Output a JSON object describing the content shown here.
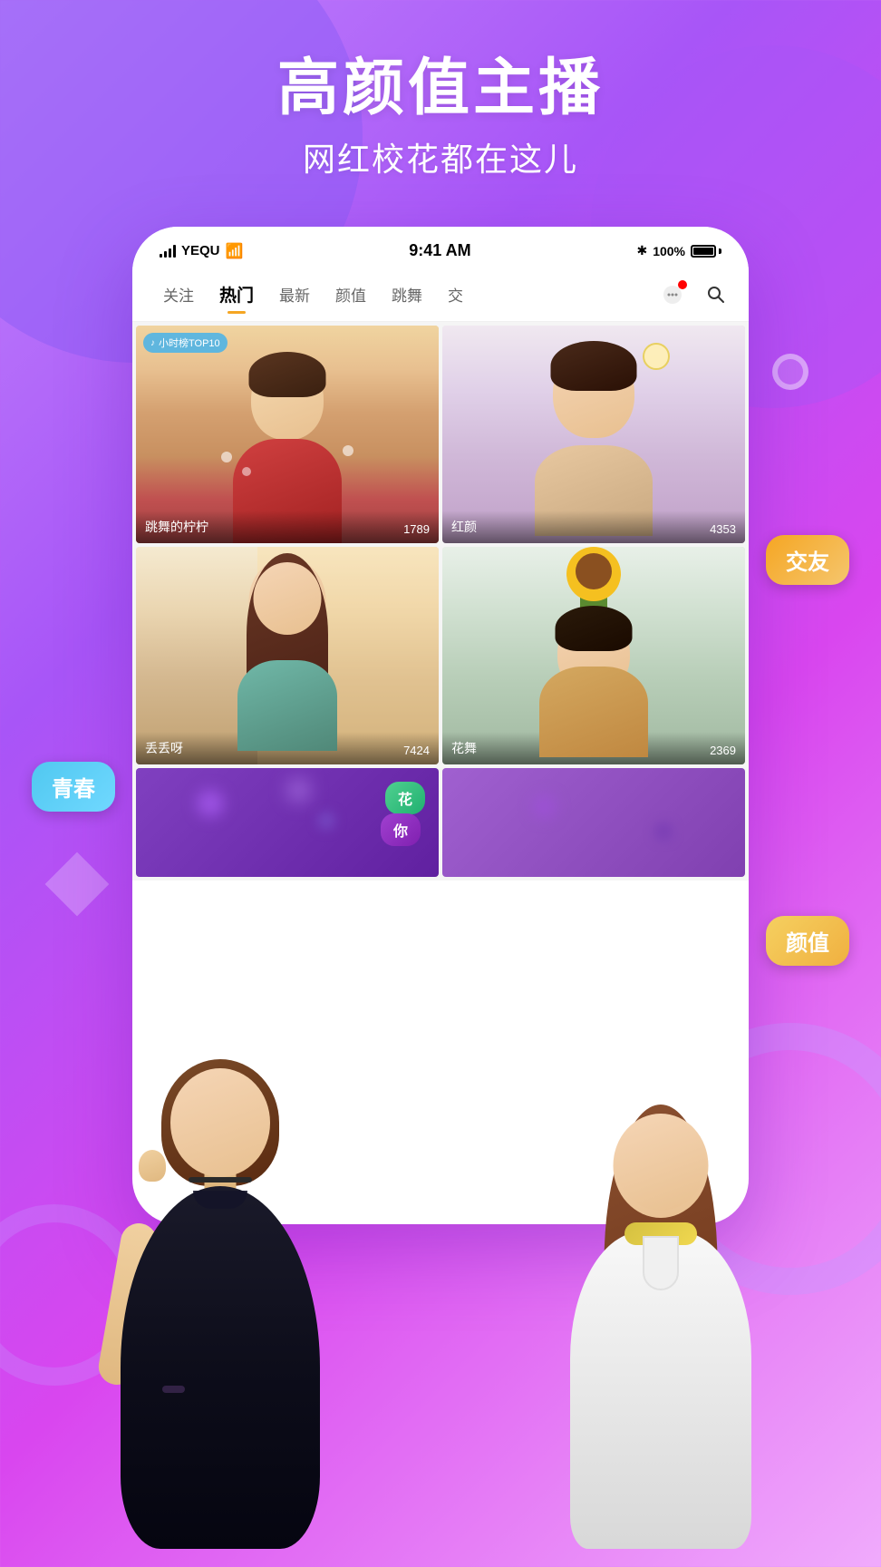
{
  "app": {
    "name": "YEQU"
  },
  "background": {
    "gradient_from": "#c084fc",
    "gradient_to": "#f0abfc"
  },
  "header": {
    "main_title": "高颜值主播",
    "sub_title": "网红校花都在这儿"
  },
  "status_bar": {
    "carrier": "YEQU",
    "time": "9:41 AM",
    "battery": "100%"
  },
  "nav_tabs": [
    {
      "label": "关注",
      "active": false
    },
    {
      "label": "热门",
      "active": true
    },
    {
      "label": "最新",
      "active": false
    },
    {
      "label": "颜值",
      "active": false
    },
    {
      "label": "跳舞",
      "active": false
    },
    {
      "label": "交",
      "active": false
    }
  ],
  "streamers": [
    {
      "name": "跳舞的柠柠",
      "count": "1789",
      "badge": "小时榜TOP10",
      "position": "top-left"
    },
    {
      "name": "红颜",
      "count": "4353",
      "badge": null,
      "position": "top-right"
    },
    {
      "name": "丢丢呀",
      "count": "7424",
      "badge": null,
      "position": "bottom-left"
    },
    {
      "name": "花舞",
      "count": "2369",
      "badge": null,
      "position": "bottom-right"
    }
  ],
  "float_tags": {
    "youjiao": "交友",
    "qingchun": "青春",
    "yanzhi": "颜值"
  },
  "bottom_overlay": {
    "tag_hua": "花",
    "tag_ni": "你"
  },
  "icons": {
    "message": "💬",
    "search": "🔍",
    "music_note": "♪"
  }
}
